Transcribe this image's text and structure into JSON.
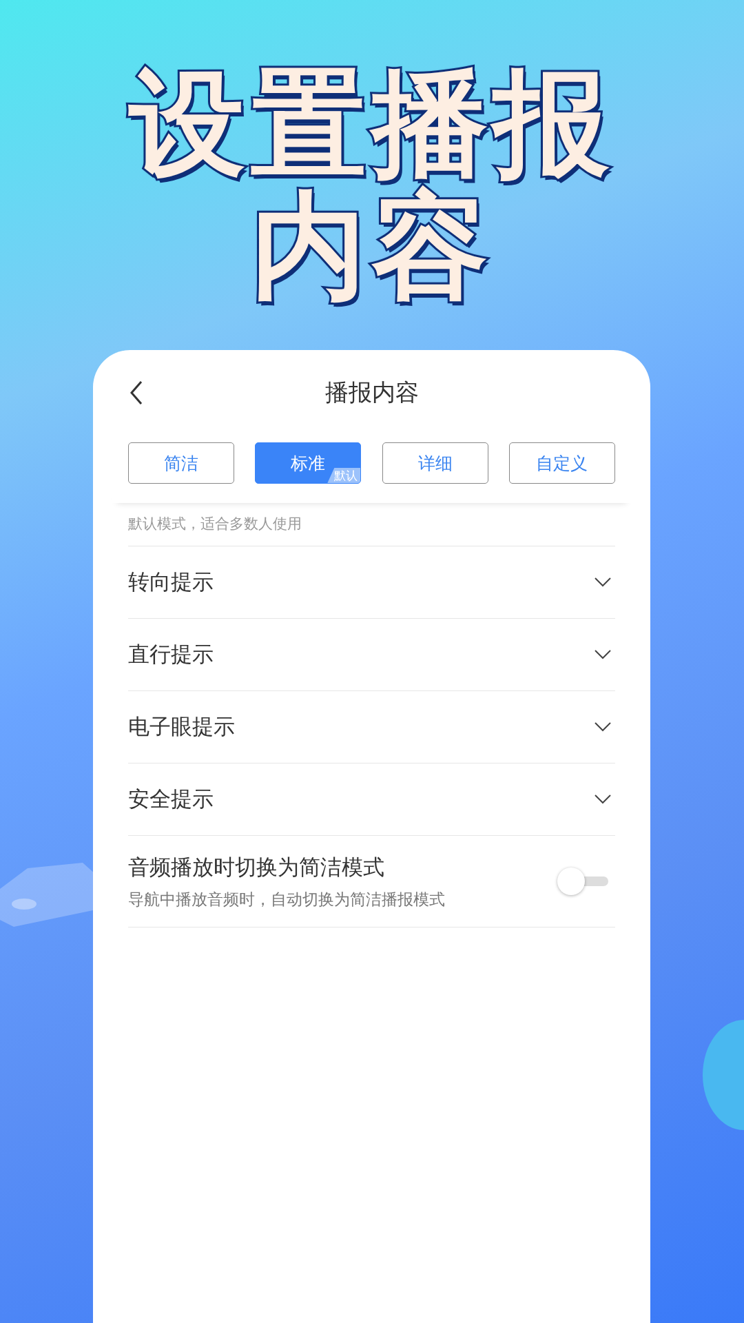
{
  "headline": [
    "设置播报",
    "内容"
  ],
  "screen": {
    "title": "播报内容",
    "modes": [
      {
        "label": "简洁",
        "selected": false
      },
      {
        "label": "标准",
        "selected": true,
        "badge": "默认"
      },
      {
        "label": "详细",
        "selected": false
      },
      {
        "label": "自定义",
        "selected": false
      }
    ],
    "description": "默认模式，适合多数人使用",
    "sections": [
      {
        "kind": "expand",
        "label": "转向提示",
        "expanded": false
      },
      {
        "kind": "expand",
        "label": "直行提示",
        "expanded": false
      },
      {
        "kind": "expand",
        "label": "电子眼提示",
        "expanded": false
      },
      {
        "kind": "expand",
        "label": "安全提示",
        "expanded": false
      },
      {
        "kind": "toggle",
        "label": "音频播放时切换为简洁模式",
        "sublabel": "导航中播放音频时，自动切换为简洁播报模式",
        "on": false
      }
    ]
  }
}
